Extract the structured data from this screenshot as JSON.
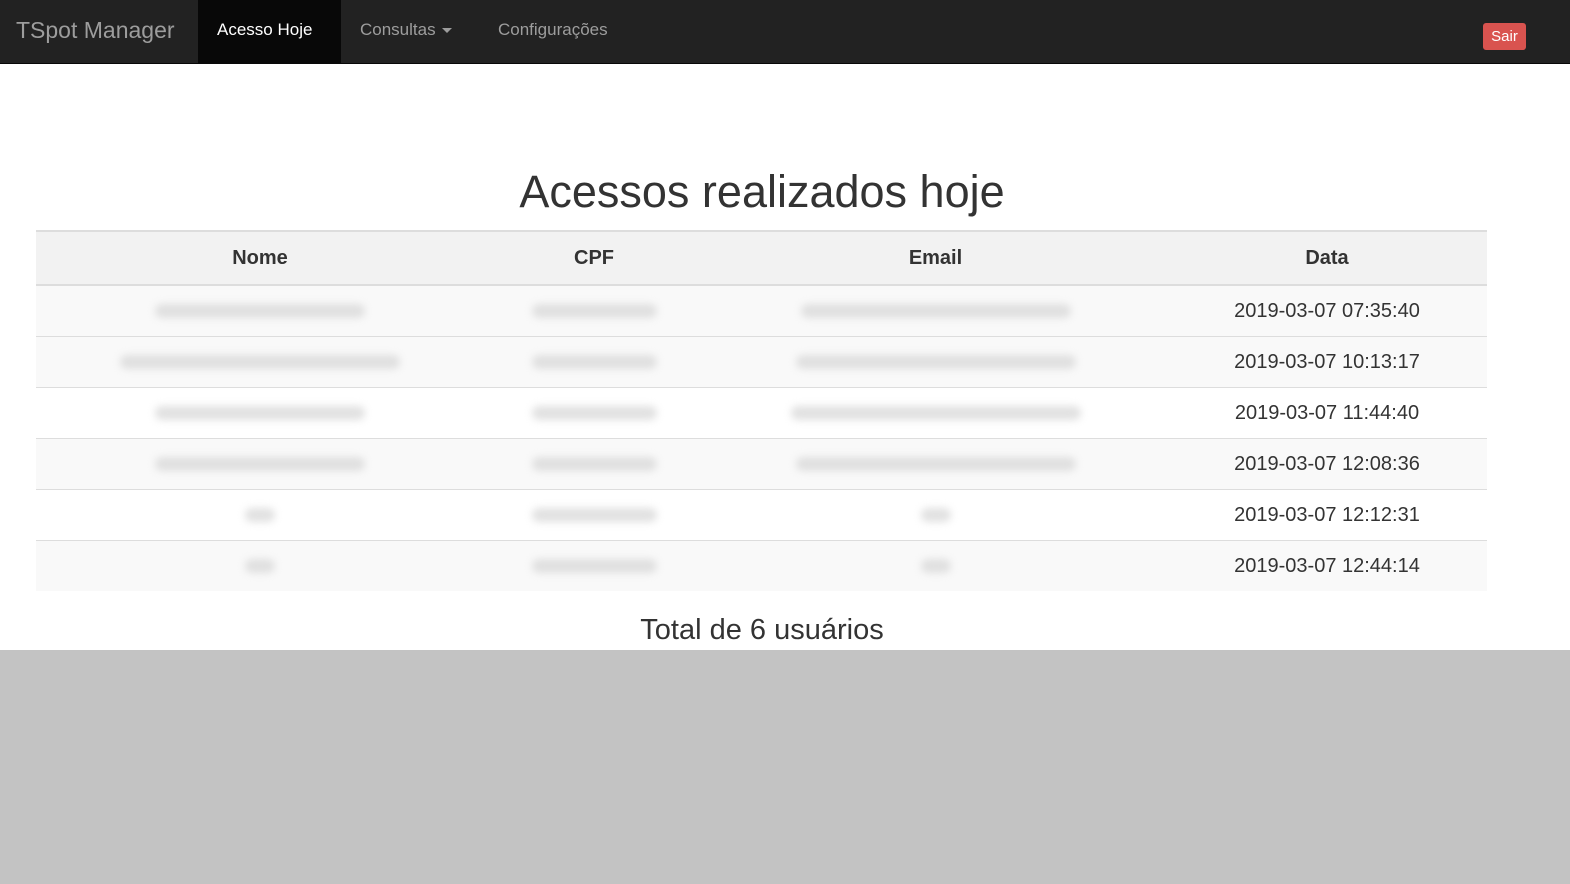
{
  "navbar": {
    "brand": "TSpot Manager",
    "items": [
      {
        "label": "Acesso Hoje",
        "active": true
      },
      {
        "label": "Consultas",
        "active": false,
        "dropdown": true
      },
      {
        "label": "Configurações",
        "active": false
      }
    ],
    "logout_label": "Sair",
    "logout_color": "#d9534f"
  },
  "main": {
    "title": "Acessos realizados hoje",
    "table": {
      "headers": [
        "Nome",
        "CPF",
        "Email",
        "Data"
      ],
      "rows": [
        {
          "data": "2019-03-07 07:35:40"
        },
        {
          "data": "2019-03-07 10:13:17"
        },
        {
          "data": "2019-03-07 11:44:40"
        },
        {
          "data": "2019-03-07 12:08:36"
        },
        {
          "data": "2019-03-07 12:12:31"
        },
        {
          "data": "2019-03-07 12:44:14"
        }
      ]
    },
    "total": "Total de 6 usuários"
  }
}
